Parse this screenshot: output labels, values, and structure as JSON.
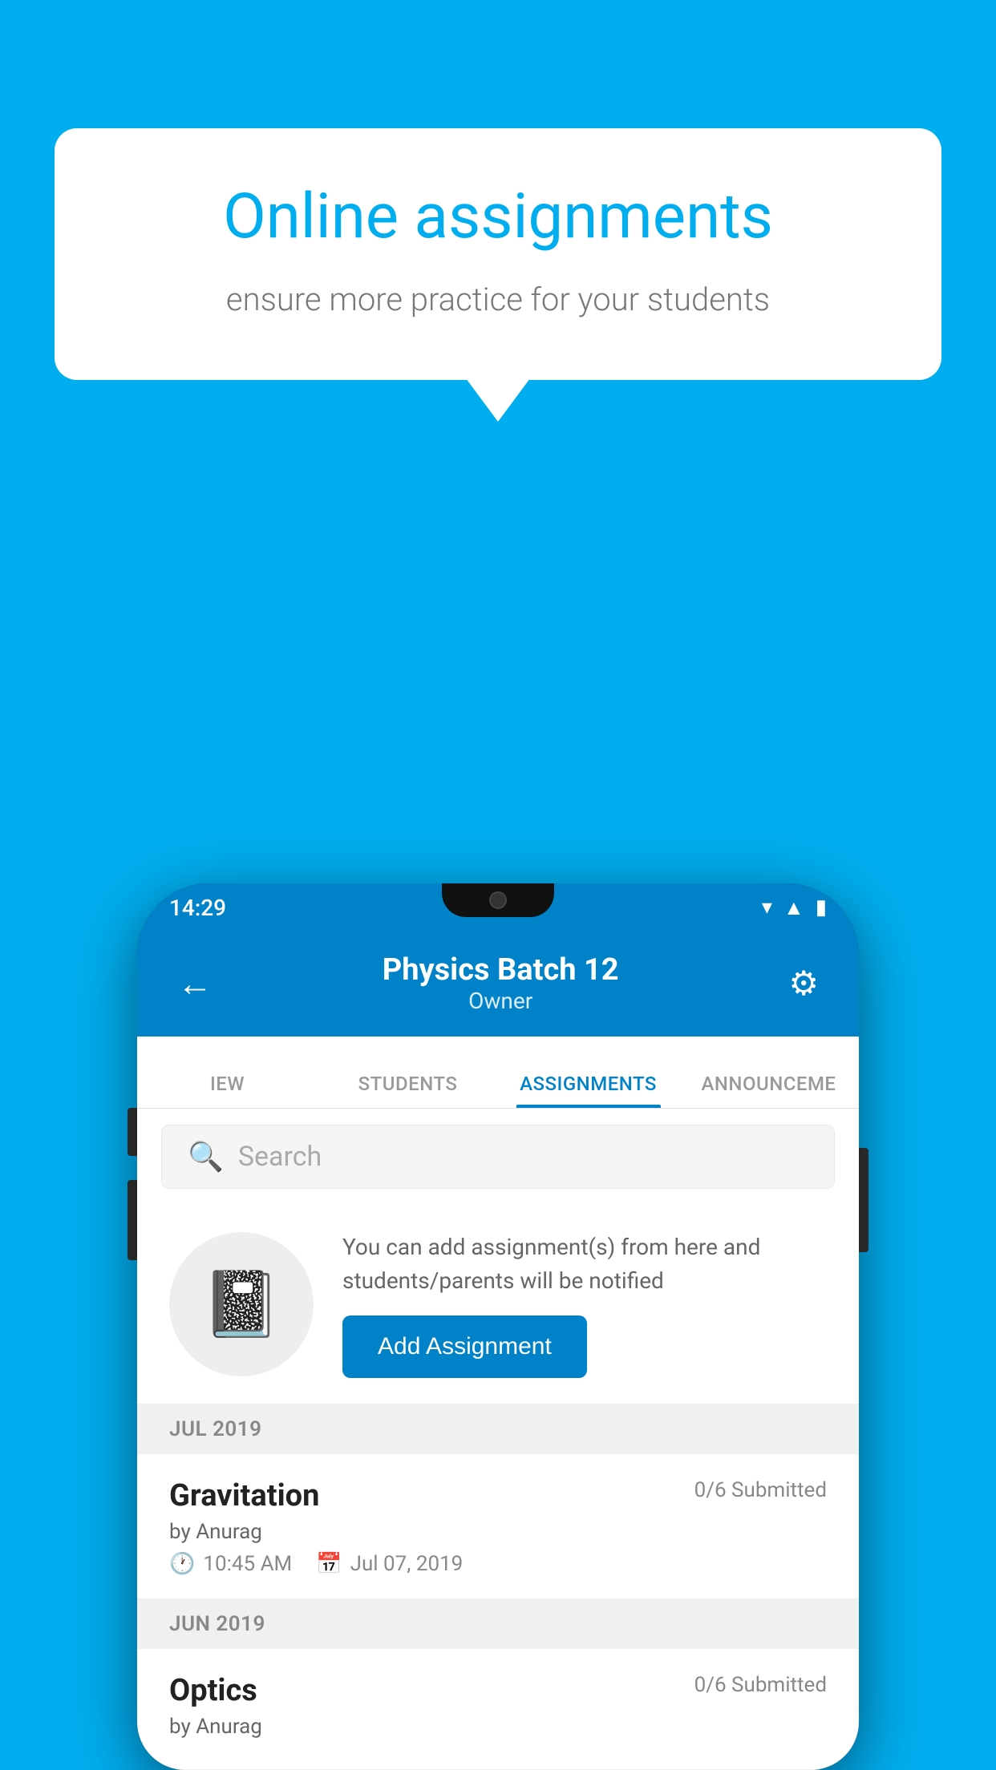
{
  "background_color": "#00AEEF",
  "bubble": {
    "title": "Online assignments",
    "subtitle": "ensure more practice for your students"
  },
  "phone": {
    "status_bar": {
      "time": "14:29",
      "icons": [
        "wifi",
        "signal",
        "battery"
      ]
    },
    "header": {
      "title": "Physics Batch 12",
      "subtitle": "Owner",
      "back_label": "←",
      "gear_label": "⚙"
    },
    "tabs": [
      {
        "label": "IEW",
        "active": false
      },
      {
        "label": "STUDENTS",
        "active": false
      },
      {
        "label": "ASSIGNMENTS",
        "active": true
      },
      {
        "label": "ANNOUNCEME",
        "active": false
      }
    ],
    "search": {
      "placeholder": "Search"
    },
    "promo": {
      "text": "You can add assignment(s) from here and students/parents will be notified",
      "button_label": "Add Assignment"
    },
    "sections": [
      {
        "label": "JUL 2019",
        "assignments": [
          {
            "name": "Gravitation",
            "submitted": "0/6 Submitted",
            "by": "by Anurag",
            "time": "10:45 AM",
            "date": "Jul 07, 2019"
          }
        ]
      },
      {
        "label": "JUN 2019",
        "assignments": [
          {
            "name": "Optics",
            "submitted": "0/6 Submitted",
            "by": "by Anurag",
            "time": "",
            "date": ""
          }
        ]
      }
    ]
  }
}
